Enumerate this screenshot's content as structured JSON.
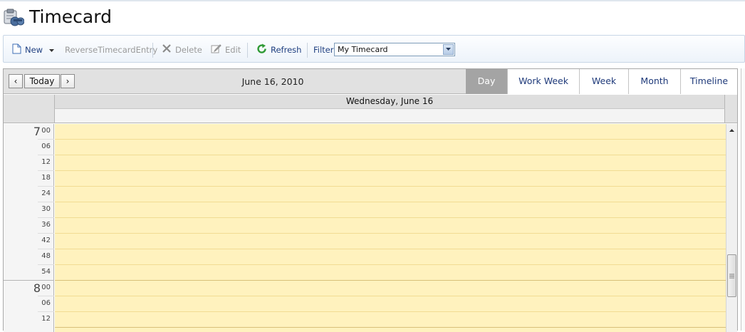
{
  "page": {
    "title": "Timecard"
  },
  "toolbar": {
    "new_label": "New",
    "reverse_label": "ReverseTimecardEntry",
    "delete_label": "Delete",
    "edit_label": "Edit",
    "refresh_label": "Refresh",
    "filter_label": "Filter",
    "filter_value": "My Timecard"
  },
  "scheduler": {
    "today_label": "Today",
    "prev_symbol": "‹",
    "next_symbol": "›",
    "current_date": "June 16, 2010",
    "views": [
      "Day",
      "Work Week",
      "Week",
      "Month",
      "Timeline"
    ],
    "active_view": "Day",
    "day_header": "Wednesday, June 16",
    "hours": [
      {
        "hour": "7",
        "minutes": [
          "00",
          "06",
          "12",
          "18",
          "24",
          "30",
          "36",
          "42",
          "48",
          "54"
        ]
      },
      {
        "hour": "8",
        "minutes": [
          "00",
          "06",
          "12"
        ]
      }
    ]
  },
  "colors": {
    "slot_background": "#fff2be",
    "active_tab": "#a4a4a4",
    "link_blue": "#1f3f80"
  },
  "icons": [
    "timecard-app-icon",
    "new-document-icon",
    "dropdown-arrow-icon",
    "delete-x-icon",
    "edit-pencil-icon",
    "refresh-icon"
  ]
}
